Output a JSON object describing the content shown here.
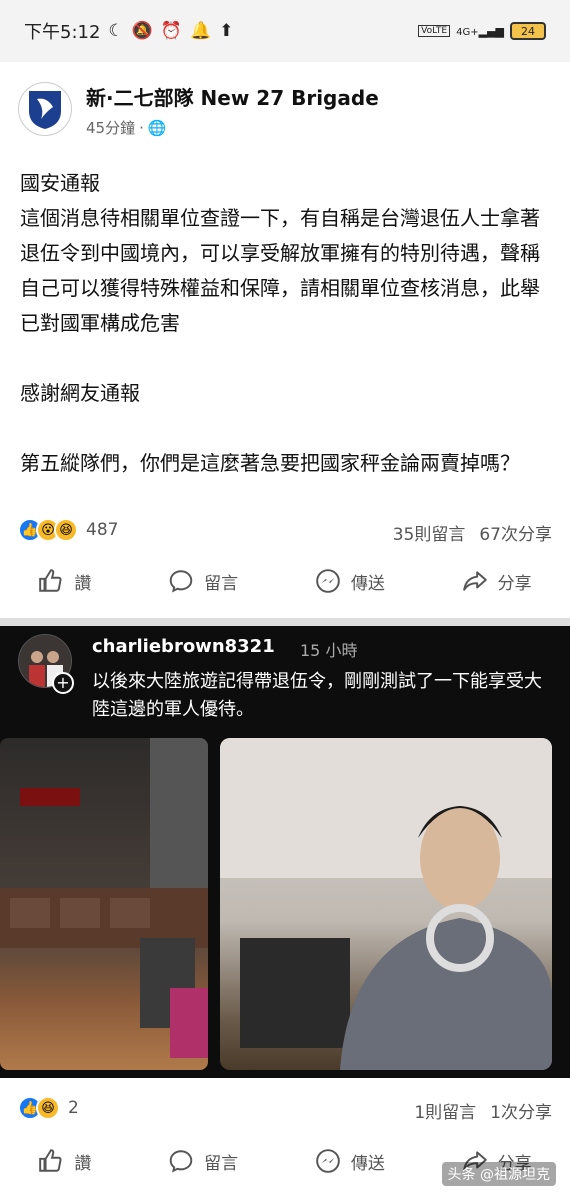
{
  "status_bar": {
    "time": "下午5:12",
    "network": "4G+",
    "volte": "VoLTE",
    "battery": "24"
  },
  "post": {
    "page_name": "新·二七部隊 New 27 Brigade",
    "time": "45分鐘",
    "privacy_sep": "·",
    "body": [
      "國安通報",
      "這個消息待相關單位查證一下，有自稱是台灣退伍人士拿著退伍令到中國境內，可以享受解放軍擁有的特別待遇，聲稱自己可以獲得特殊權益和保障，請相關單位查核消息，此舉已對國軍構成危害",
      "",
      "感謝網友通報",
      "",
      "第五縱隊們，你們是這麼著急要把國家秤金論兩賣掉嗎？"
    ],
    "reactions_count": "487",
    "comments": "35則留言",
    "shares": "67次分享"
  },
  "actions": {
    "like": "讚",
    "comment": "留言",
    "send": "傳送",
    "share": "分享"
  },
  "embedded": {
    "username": "charliebrown8321",
    "time": "15 小時",
    "text": "以後來大陸旅遊記得帶退伍令，剛剛測試了一下能享受大陸這邊的軍人優待。"
  },
  "post2": {
    "reactions_count": "2",
    "comments": "1則留言",
    "shares": "1次分享"
  },
  "watermark": "头条 @祖源坦克",
  "colors": {
    "like_blue": "#1877f2",
    "haha_yellow": "#f7b928",
    "divider": "#dddddd"
  }
}
